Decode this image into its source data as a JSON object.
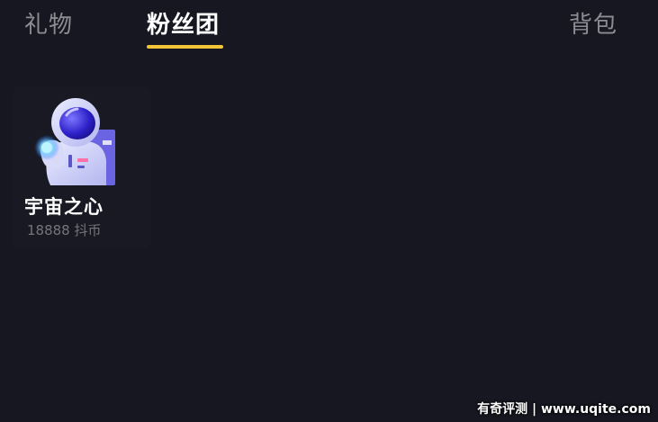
{
  "tabs": [
    {
      "label": "礼物",
      "active": false
    },
    {
      "label": "粉丝团",
      "active": true
    },
    {
      "label": "背包",
      "active": false
    }
  ],
  "gift": {
    "name": "宇宙之心",
    "price": "18888 抖币",
    "icon": "astronaut-icon"
  },
  "watermark": "有奇评测 | www.uqite.com",
  "colors": {
    "background": "#161720",
    "accent": "#f2c437",
    "tab_inactive": "#8c8d93",
    "price_text": "#75767d"
  }
}
